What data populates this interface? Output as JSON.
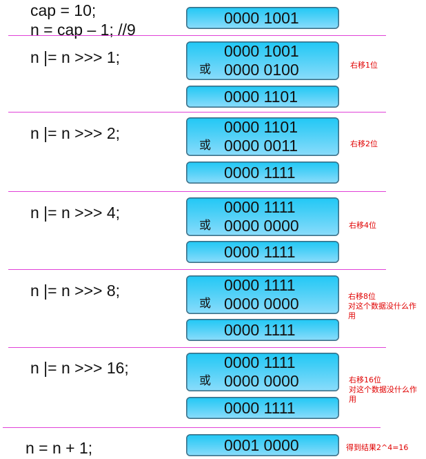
{
  "init": {
    "line1": "cap = 10;",
    "line2": "n = cap – 1; //9",
    "value": "0000 1001"
  },
  "or_symbol": "或",
  "steps": [
    {
      "code": "n |= n >>> 1;",
      "a": "0000 1001",
      "b": "0000 0100",
      "result": "0000 1101",
      "note1": "右移1位",
      "note2": "",
      "note3": ""
    },
    {
      "code": "n |= n >>> 2;",
      "a": "0000 1101",
      "b": "0000 0011",
      "result": "0000 1111",
      "note1": "右移2位",
      "note2": "",
      "note3": ""
    },
    {
      "code": "n |= n >>> 4;",
      "a": "0000 1111",
      "b": "0000 0000",
      "result": "0000 1111",
      "note1": "右移4位",
      "note2": "",
      "note3": ""
    },
    {
      "code": "n |= n >>> 8;",
      "a": "0000 1111",
      "b": "0000 0000",
      "result": "0000 1111",
      "note1": "右移8位",
      "note2": "对这个数据没什么作",
      "note3": "用"
    },
    {
      "code": "n |= n >>> 16;",
      "a": "0000 1111",
      "b": "0000 0000",
      "result": "0000 1111",
      "note1": "右移16位",
      "note2": "对这个数据没什么作",
      "note3": "用"
    }
  ],
  "final": {
    "code": "n = n + 1;",
    "value": "0001 0000",
    "note": "得到结果2^4=16"
  }
}
